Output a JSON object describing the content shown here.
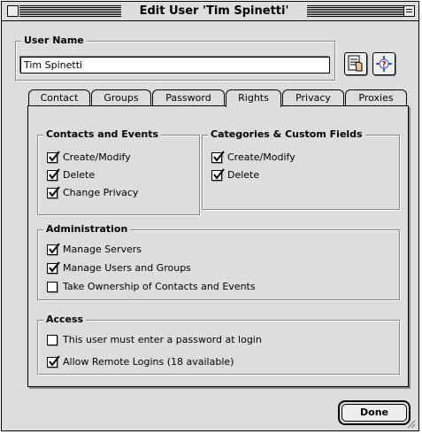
{
  "window": {
    "title": "Edit User 'Tim Spinetti'"
  },
  "user_name": {
    "label": "User Name",
    "value": "Tim Spinetti"
  },
  "icons": {
    "notes": "notes-hand-icon",
    "help": "help-question-icon"
  },
  "tabs": [
    {
      "label": "Contact",
      "active": false
    },
    {
      "label": "Groups",
      "active": false
    },
    {
      "label": "Password",
      "active": false
    },
    {
      "label": "Rights",
      "active": true
    },
    {
      "label": "Privacy",
      "active": false
    },
    {
      "label": "Proxies",
      "active": false
    }
  ],
  "rights": {
    "contacts_events": {
      "title": "Contacts and Events",
      "items": [
        {
          "label": "Create/Modify",
          "checked": true
        },
        {
          "label": "Delete",
          "checked": true
        },
        {
          "label": "Change Privacy",
          "checked": true
        }
      ]
    },
    "categories": {
      "title": "Categories & Custom Fields",
      "items": [
        {
          "label": "Create/Modify",
          "checked": true
        },
        {
          "label": "Delete",
          "checked": true
        }
      ]
    },
    "administration": {
      "title": "Administration",
      "items": [
        {
          "label": "Manage Servers",
          "checked": true
        },
        {
          "label": "Manage Users and Groups",
          "checked": true
        },
        {
          "label": "Take Ownership of Contacts and Events",
          "checked": false
        }
      ]
    },
    "access": {
      "title": "Access",
      "items": [
        {
          "label": "This user must enter a password at login",
          "checked": false
        },
        {
          "label": "Allow Remote Logins (18 available)",
          "checked": true
        }
      ]
    }
  },
  "buttons": {
    "done": "Done"
  }
}
